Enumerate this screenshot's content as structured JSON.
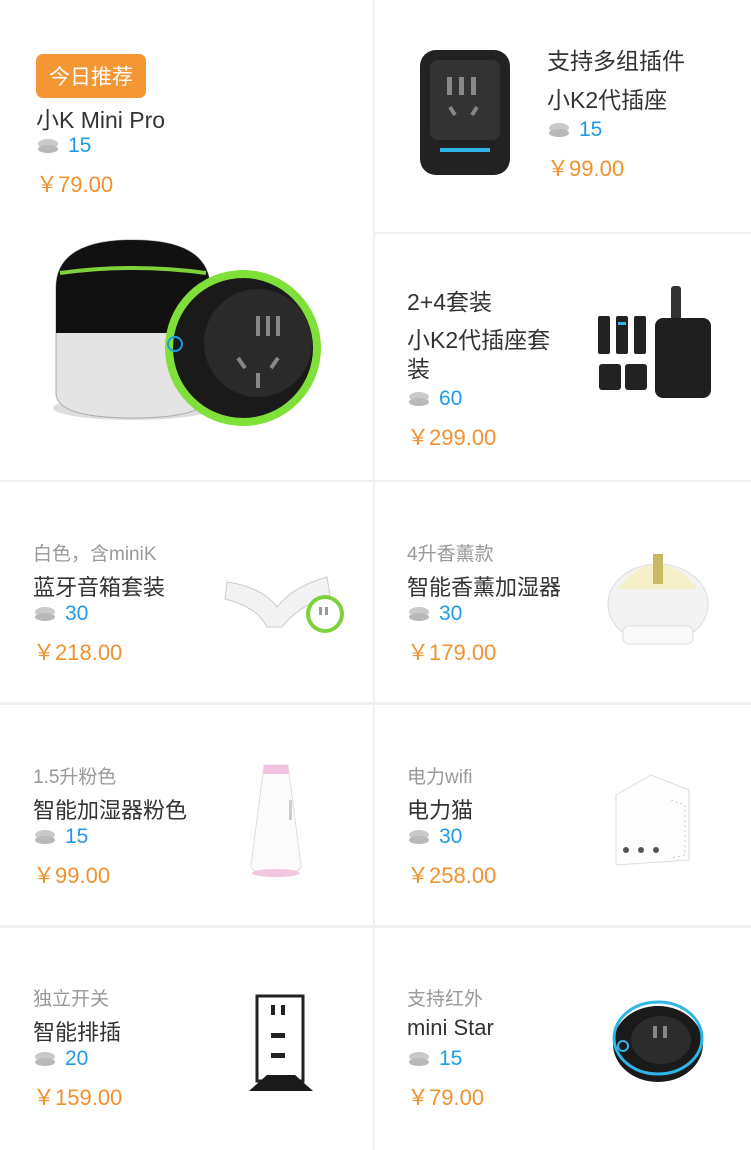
{
  "featured": {
    "badge": "今日推荐",
    "name": "小K Mini Pro",
    "coins": "15",
    "price": "￥79.00",
    "image": "kmini-pro-image"
  },
  "top_right": [
    {
      "subtitle": "支持多组插件",
      "name": "小K2代插座",
      "coins": "15",
      "price": "￥99.00"
    },
    {
      "subtitle": "2+4套装",
      "name": "小K2代插座套装",
      "coins": "60",
      "price": "￥299.00"
    }
  ],
  "products": [
    {
      "subtitle": "白色，含miniK",
      "name": "蓝牙音箱套装",
      "coins": "30",
      "price": "￥218.00"
    },
    {
      "subtitle": "4升香薰款",
      "name": "智能香薰加湿器",
      "coins": "30",
      "price": "￥179.00"
    },
    {
      "subtitle": "1.5升粉色",
      "name": "智能加湿器粉色",
      "coins": "15",
      "price": "￥99.00"
    },
    {
      "subtitle": "电力wifi",
      "name": "电力猫",
      "coins": "30",
      "price": "￥258.00"
    },
    {
      "subtitle": "独立开关",
      "name": "智能排插",
      "coins": "20",
      "price": "￥159.00"
    },
    {
      "subtitle": "支持红外",
      "name": "mini Star",
      "coins": "15",
      "price": "￥79.00"
    }
  ],
  "colors": {
    "accent": "#f39633",
    "coin": "#1f9ae8",
    "price": "#f2912d"
  }
}
